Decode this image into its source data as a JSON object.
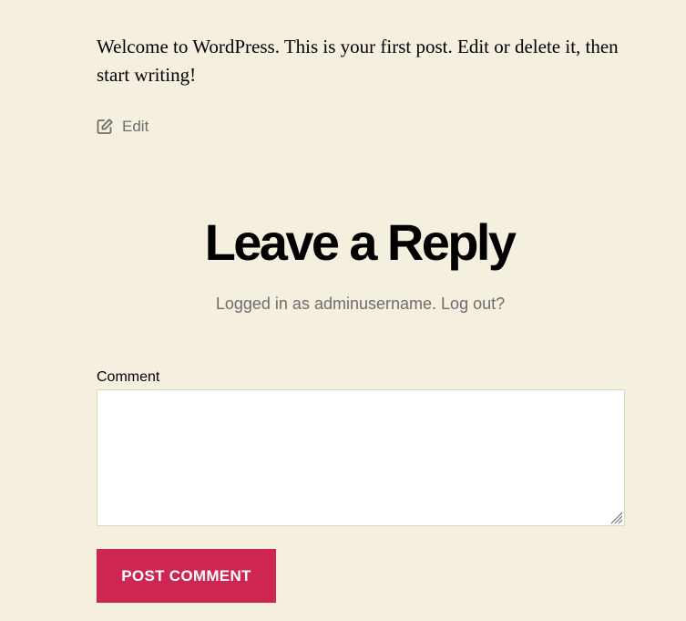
{
  "post": {
    "content": "Welcome to WordPress. This is your first post. Edit or delete it, then start writing!",
    "edit_label": "Edit"
  },
  "reply": {
    "title": "Leave a Reply",
    "logged_in_prefix": "Logged in as ",
    "username": "adminusername",
    "separator": ". ",
    "logout_label": "Log out?",
    "comment_label": "Comment",
    "comment_value": "",
    "submit_label": "POST COMMENT"
  },
  "icons": {
    "edit": "edit-icon",
    "resize": "resize-handle-icon"
  },
  "colors": {
    "background": "#f5efe0",
    "accent": "#cd2653",
    "secondary_text": "#6d6d6d",
    "border": "#dcd7ca"
  }
}
